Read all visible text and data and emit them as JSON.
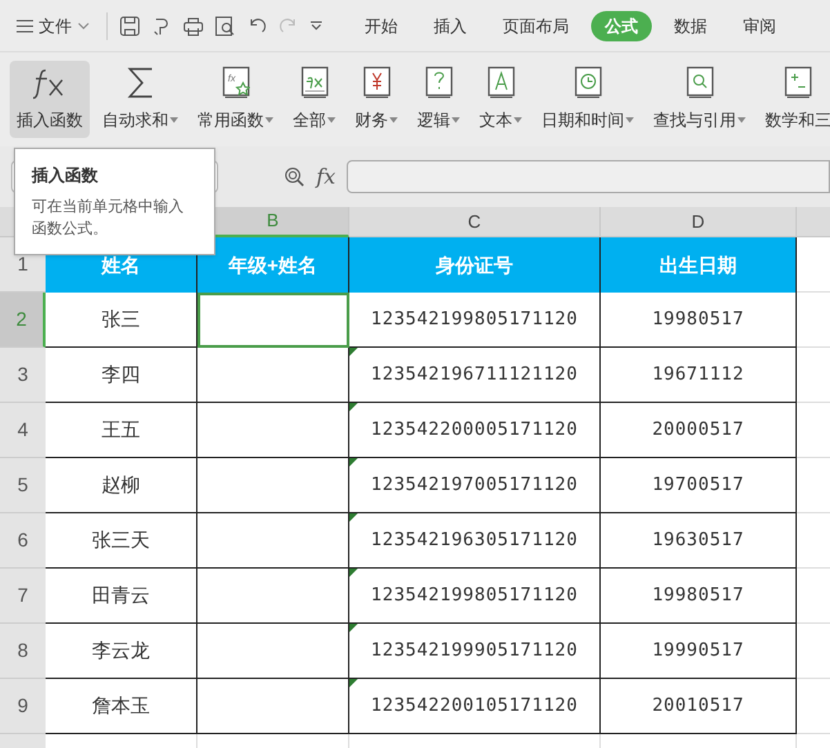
{
  "menu_bar": {
    "file_label": "文件",
    "tabs": [
      {
        "label": "开始",
        "selected": false
      },
      {
        "label": "插入",
        "selected": false
      },
      {
        "label": "页面布局",
        "selected": false
      },
      {
        "label": "公式",
        "selected": true
      },
      {
        "label": "数据",
        "selected": false
      },
      {
        "label": "审阅",
        "selected": false
      }
    ]
  },
  "ribbon": [
    {
      "kind": "fx",
      "label": "插入函数",
      "dropdown": false,
      "selected": true
    },
    {
      "kind": "sum",
      "label": "自动求和",
      "dropdown": true,
      "selected": false
    },
    {
      "kind": "star",
      "label": "常用函数",
      "dropdown": true,
      "selected": false
    },
    {
      "kind": "fxbook",
      "label": "全部",
      "dropdown": true,
      "selected": false
    },
    {
      "kind": "yen",
      "label": "财务",
      "dropdown": true,
      "selected": false
    },
    {
      "kind": "question",
      "label": "逻辑",
      "dropdown": true,
      "selected": false
    },
    {
      "kind": "letter",
      "label": "文本",
      "dropdown": true,
      "selected": false
    },
    {
      "kind": "clock",
      "label": "日期和时间",
      "dropdown": true,
      "selected": false
    },
    {
      "kind": "search",
      "label": "查找与引用",
      "dropdown": true,
      "selected": false
    },
    {
      "kind": "plusminus",
      "label": "数学和三",
      "dropdown": false,
      "selected": false
    }
  ],
  "tooltip": {
    "title": "插入函数",
    "text": "可在当前单元格中输入函数公式。"
  },
  "formula_bar": {
    "fx_label": "fx"
  },
  "sheet": {
    "columns": [
      {
        "label": "B",
        "selected": true
      },
      {
        "label": "C",
        "selected": false
      },
      {
        "label": "D",
        "selected": false
      }
    ],
    "header_row": {
      "number": "1",
      "cells": [
        "姓名",
        "年级+姓名",
        "身份证号",
        "出生日期"
      ]
    },
    "rows": [
      {
        "number": "2",
        "selected": true,
        "name": "张三",
        "id": "123542199805171120",
        "birth": "19980517",
        "flag": false
      },
      {
        "number": "3",
        "selected": false,
        "name": "李四",
        "id": "123542196711121120",
        "birth": "19671112",
        "flag": true
      },
      {
        "number": "4",
        "selected": false,
        "name": "王五",
        "id": "123542200005171120",
        "birth": "20000517",
        "flag": true
      },
      {
        "number": "5",
        "selected": false,
        "name": "赵柳",
        "id": "123542197005171120",
        "birth": "19700517",
        "flag": true
      },
      {
        "number": "6",
        "selected": false,
        "name": "张三天",
        "id": "123542196305171120",
        "birth": "19630517",
        "flag": true
      },
      {
        "number": "7",
        "selected": false,
        "name": "田青云",
        "id": "123542199805171120",
        "birth": "19980517",
        "flag": true
      },
      {
        "number": "8",
        "selected": false,
        "name": "李云龙",
        "id": "123542199905171120",
        "birth": "19990517",
        "flag": true
      },
      {
        "number": "9",
        "selected": false,
        "name": "詹本玉",
        "id": "123542200105171120",
        "birth": "20010517",
        "flag": true
      }
    ]
  }
}
